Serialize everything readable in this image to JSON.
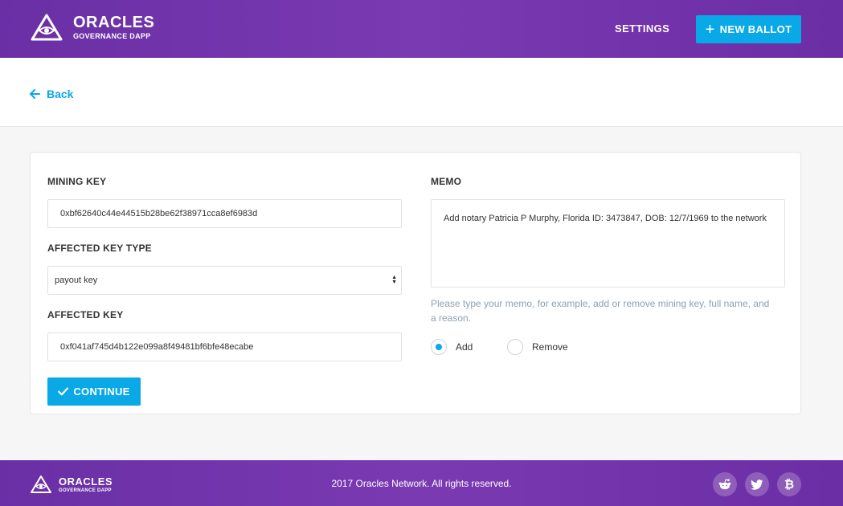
{
  "header": {
    "logo_title": "ORACLES",
    "logo_subtitle": "GOVERNANCE DAPP",
    "settings_label": "SETTINGS",
    "new_ballot_label": "NEW BALLOT"
  },
  "nav": {
    "back_label": "Back"
  },
  "form": {
    "mining_key": {
      "label": "MINING KEY",
      "value": "0xbf62640c44e44515b28be62f38971cca8ef6983d"
    },
    "affected_key_type": {
      "label": "AFFECTED KEY TYPE",
      "selected": "payout key"
    },
    "affected_key": {
      "label": "AFFECTED KEY",
      "value": "0xf041af745d4b122e099a8f49481bf6bfe48ecabe"
    },
    "memo": {
      "label": "MEMO",
      "value": "Add notary Patricia P Murphy, Florida ID: 3473847, DOB: 12/7/1969 to the network",
      "hint": "Please type your memo, for example, add or remove mining key, full name, and a reason."
    },
    "action": {
      "options": [
        {
          "label": "Add",
          "checked": true
        },
        {
          "label": "Remove",
          "checked": false
        }
      ]
    },
    "continue_label": "CONTINUE"
  },
  "footer": {
    "logo_title": "ORACLES",
    "logo_subtitle": "GOVERNANCE DAPP",
    "copyright": "2017 Oracles Network. All rights reserved.",
    "social_icons": [
      "reddit-icon",
      "twitter-icon",
      "bitcoin-icon"
    ]
  },
  "colors": {
    "header_purple": "#6a2fa5",
    "accent_blue": "#08a9e6",
    "hint_gray": "#8fa0b2"
  }
}
